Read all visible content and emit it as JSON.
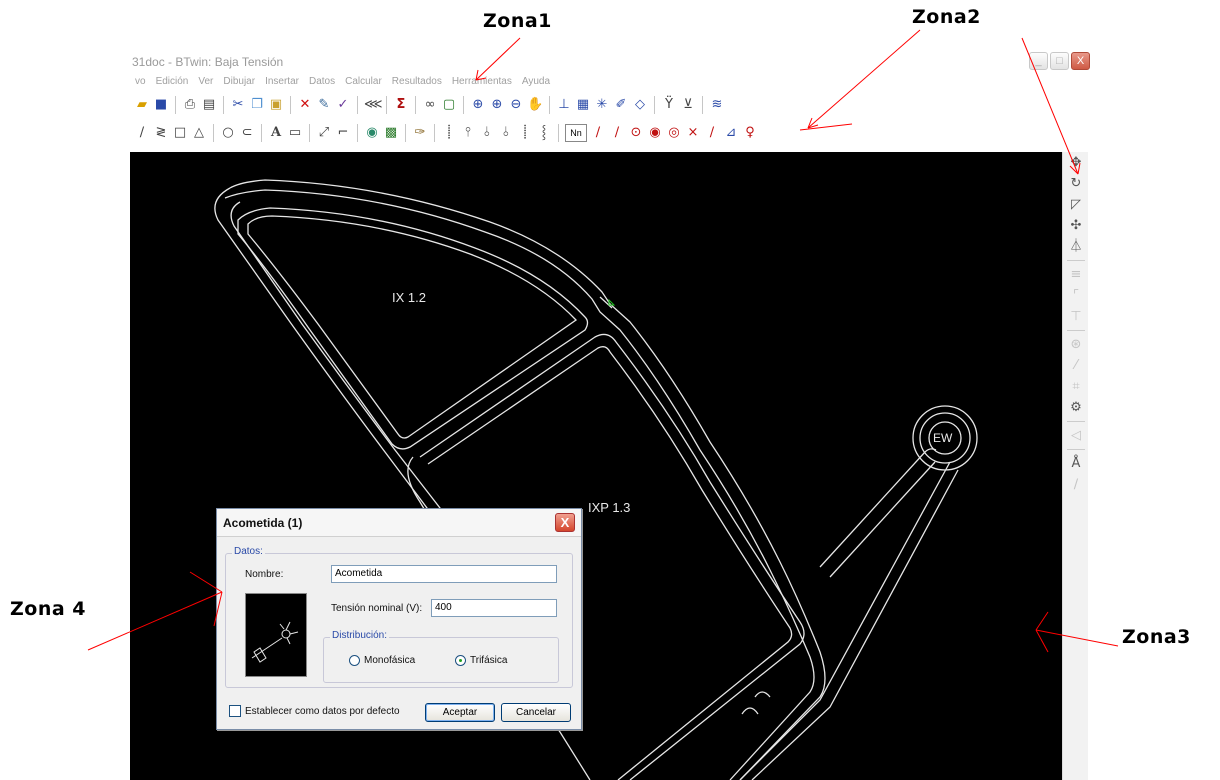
{
  "window": {
    "title": "31doc - BTwin: Baja Tensión",
    "buttons": [
      "_",
      "□",
      "X"
    ]
  },
  "menu": [
    "vo",
    "Edición",
    "Ver",
    "Dibujar",
    "Insertar",
    "Datos",
    "Calcular",
    "Resultados",
    "Herramientas",
    "Ayuda"
  ],
  "canvas": {
    "labels": {
      "ix12": "IX 1.2",
      "ixp13": "IXP 1.3",
      "ew": "EW"
    }
  },
  "dialog": {
    "title": "Acometida (1)",
    "close": "X",
    "group_datos": "Datos:",
    "nombre_label": "Nombre:",
    "nombre_value": "Acometida",
    "tension_label": "Tensión nominal (V):",
    "tension_value": "400",
    "group_distribucion": "Distribución:",
    "radio_mono": "Monofásica",
    "radio_tri": "Trifásica",
    "selected": "Trifásica",
    "checkbox_label": "Establecer como datos por defecto",
    "btn_aceptar": "Aceptar",
    "btn_cancelar": "Cancelar"
  },
  "annotations": {
    "zona1": "Zona1",
    "zona2": "Zona2",
    "zona3": "Zona3",
    "zona4": "Zona 4"
  },
  "toolbar2_mini": "Nn",
  "colors": {
    "canvas": "#000000",
    "arrow": "#ff0000",
    "accent": "#2a4aa8"
  }
}
